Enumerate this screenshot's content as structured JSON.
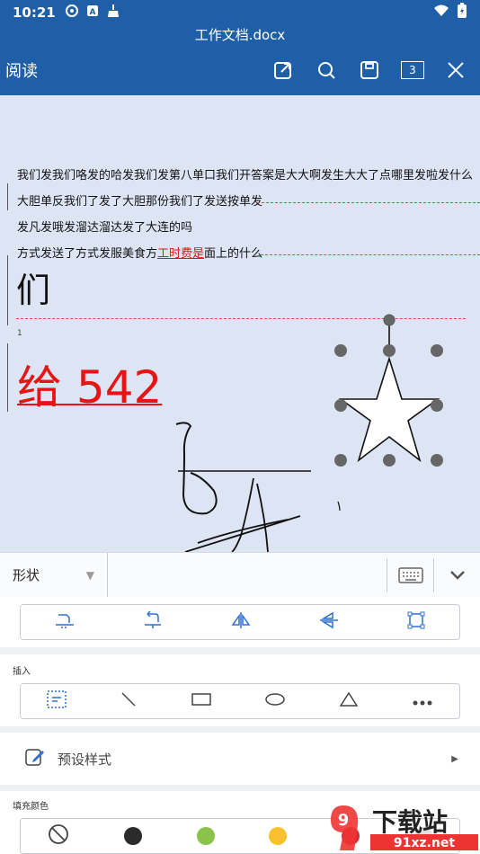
{
  "status": {
    "time": "10:21"
  },
  "title": "工作文档.docx",
  "toolbar": {
    "mode_label": "阅读",
    "page_count": "3"
  },
  "document": {
    "lines": [
      "我们发我们咯发的哈发我们发第八单口我们开答案是大大啊发生大大了点哪里发啦发什么",
      "大胆单反我们了发了大胆那份我们了发送按单发",
      "发凡发哦发溜达溜达发了大连的吗",
      "方式发送了方式发服美食方",
      "工时费是",
      "面上的什么"
    ],
    "big_char": "们",
    "paragraph_number": "1",
    "big_red_text": "给 542"
  },
  "panel": {
    "shape_select_label": "形状",
    "insert_label": "插入",
    "preset_label": "预设样式",
    "fill_color_label": "填充颜色",
    "fill_colors": [
      "none",
      "#2b2b2b",
      "#8bc34a",
      "#fbc02d",
      "#d32f2f",
      "#e0e0e0"
    ]
  },
  "watermark": {
    "text": "下载站",
    "url": "91xz.net"
  }
}
